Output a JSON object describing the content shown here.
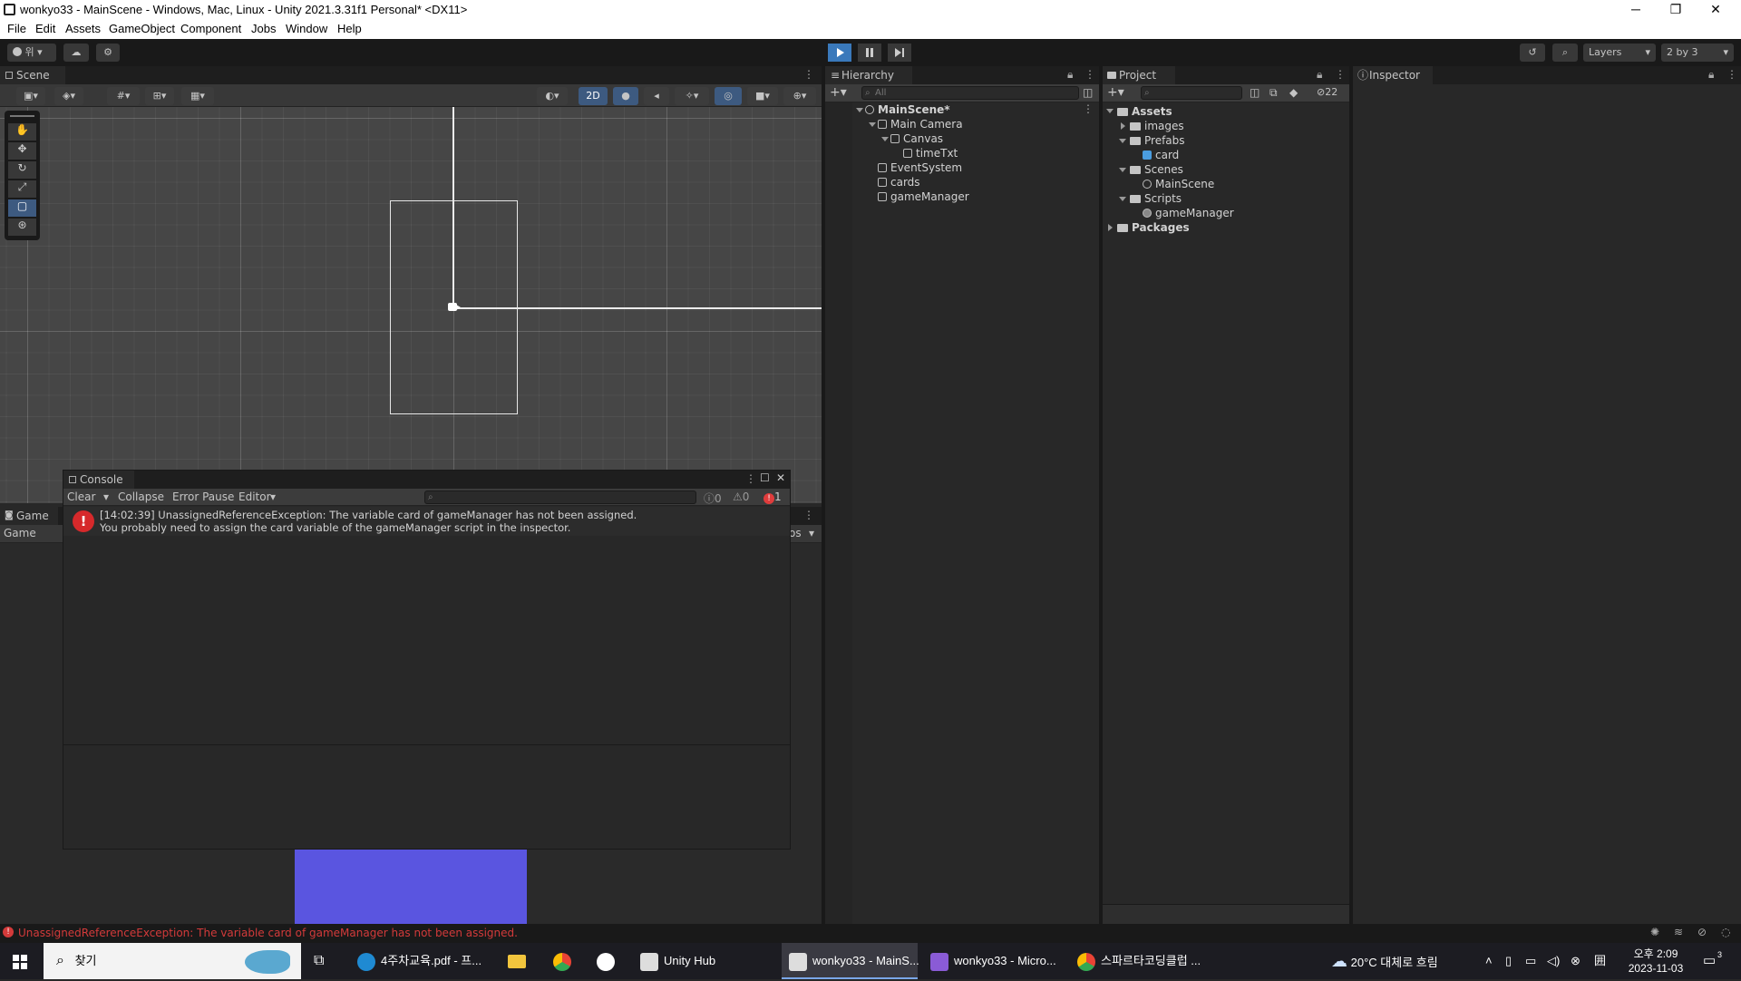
{
  "window": {
    "title": "wonkyo33 - MainScene - Windows, Mac, Linux - Unity 2021.3.31f1 Personal* <DX11>",
    "minimize": "─",
    "restore": "❐",
    "close": "✕"
  },
  "menu": [
    "File",
    "Edit",
    "Assets",
    "GameObject",
    "Component",
    "Jobs",
    "Window",
    "Help"
  ],
  "toolbar": {
    "account_label": "위",
    "layers_label": "Layers",
    "layout_label": "2 by 3",
    "play_active": true
  },
  "scene": {
    "tab_label": "Scene",
    "mode_2d": "2D"
  },
  "game": {
    "tab_label": "Game",
    "display_label": "Game",
    "stats_partial": "os",
    "card_color": "#5a55e0"
  },
  "console": {
    "tab_label": "Console",
    "clear": "Clear",
    "collapse": "Collapse",
    "error_pause": "Error Pause",
    "editor": "Editor",
    "log_count": "0",
    "warn_count": "0",
    "error_count": "1",
    "entries": [
      {
        "line1": "[14:02:39] UnassignedReferenceException: The variable card of gameManager has not been assigned.",
        "line2": "You probably need to assign the card variable of the gameManager script in the inspector."
      }
    ]
  },
  "hierarchy": {
    "tab_label": "Hierarchy",
    "search_placeholder": "All",
    "scene_name": "MainScene*",
    "items": [
      "Main Camera",
      "Canvas",
      "timeTxt",
      "EventSystem",
      "cards",
      "gameManager"
    ]
  },
  "project": {
    "tab_label": "Project",
    "hidden_count": "22",
    "assets_label": "Assets",
    "items": [
      "images",
      "Prefabs",
      "card",
      "Scenes",
      "MainScene",
      "Scripts",
      "gameManager"
    ],
    "packages_label": "Packages"
  },
  "inspector": {
    "tab_label": "Inspector"
  },
  "statusbar": {
    "message": "UnassignedReferenceException: The variable card of gameManager has not been assigned.",
    "color": "#d33a3a"
  },
  "taskbar": {
    "search_label": "찾기",
    "apps": [
      "4주차교육.pdf - 프...",
      "Unity Hub",
      "wonkyo33 - MainS...",
      "wonkyo33 - Micro...",
      "스파르타코딩클럽 ..."
    ],
    "weather": "20°C 대체로 흐림",
    "time": "오후 2:09",
    "date": "2023-11-03",
    "notif_count": "3"
  }
}
